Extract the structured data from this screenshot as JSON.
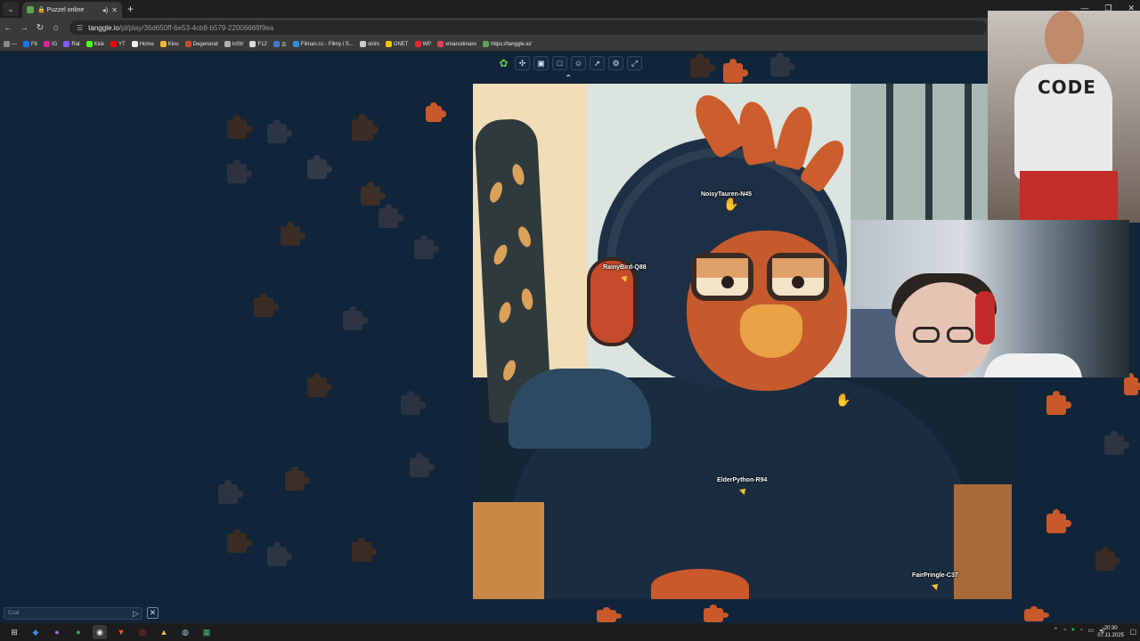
{
  "browser": {
    "tab_title": "🔒 Puzzel online",
    "url_host": "tanggle.io",
    "url_path": "/pl/play/36d650ff-6e53-4cb8-b579-22006669f9ea",
    "bookmarks": [
      {
        "label": "—",
        "color": "#8a8a8a"
      },
      {
        "label": "Fb",
        "color": "#1877f2"
      },
      {
        "label": "IG",
        "color": "#d6249f"
      },
      {
        "label": "Rat",
        "color": "#7b5cff"
      },
      {
        "label": "Kick",
        "color": "#53fc18"
      },
      {
        "label": "YT",
        "color": "#ff0000"
      },
      {
        "label": "Home",
        "color": "#eeeeee"
      },
      {
        "label": "Kino",
        "color": "#f2b233"
      },
      {
        "label": "Degenerat",
        "color": "#c44c2c"
      },
      {
        "label": "InStr",
        "color": "#b0b0b0"
      },
      {
        "label": "F12",
        "color": "#dddddd"
      },
      {
        "label": "五",
        "color": "#3b7bd6"
      },
      {
        "label": "Filman.cc - Filmy i S...",
        "color": "#2d8fd6"
      },
      {
        "label": "strim",
        "color": "#cccccc"
      },
      {
        "label": "ONET",
        "color": "#f5c400"
      },
      {
        "label": "WP",
        "color": "#e2262b"
      },
      {
        "label": "xmarcelinaxx",
        "color": "#e4405f"
      },
      {
        "label": "https://tanggle.io/",
        "color": "#5aa84d"
      }
    ]
  },
  "game": {
    "players": [
      {
        "name": "NoisyTauren-N45"
      },
      {
        "name": "RainyBird-Q88"
      },
      {
        "name": "ElderPython-R94"
      },
      {
        "name": "FairPringle-C37"
      }
    ],
    "toolbar": [
      "logo-icon",
      "puzzle-icon",
      "image-icon",
      "square-icon",
      "players-icon",
      "share-icon",
      "settings-icon",
      "fullscreen-icon"
    ],
    "chat_placeholder": "Czat"
  },
  "webcam": {
    "shirt_text": "CODE"
  },
  "taskbar": {
    "time": "20:30",
    "date": "07.11.2025"
  },
  "colors": {
    "background": "#10253a",
    "accent": "#c75a2c",
    "cursor": "#f3c23a"
  }
}
